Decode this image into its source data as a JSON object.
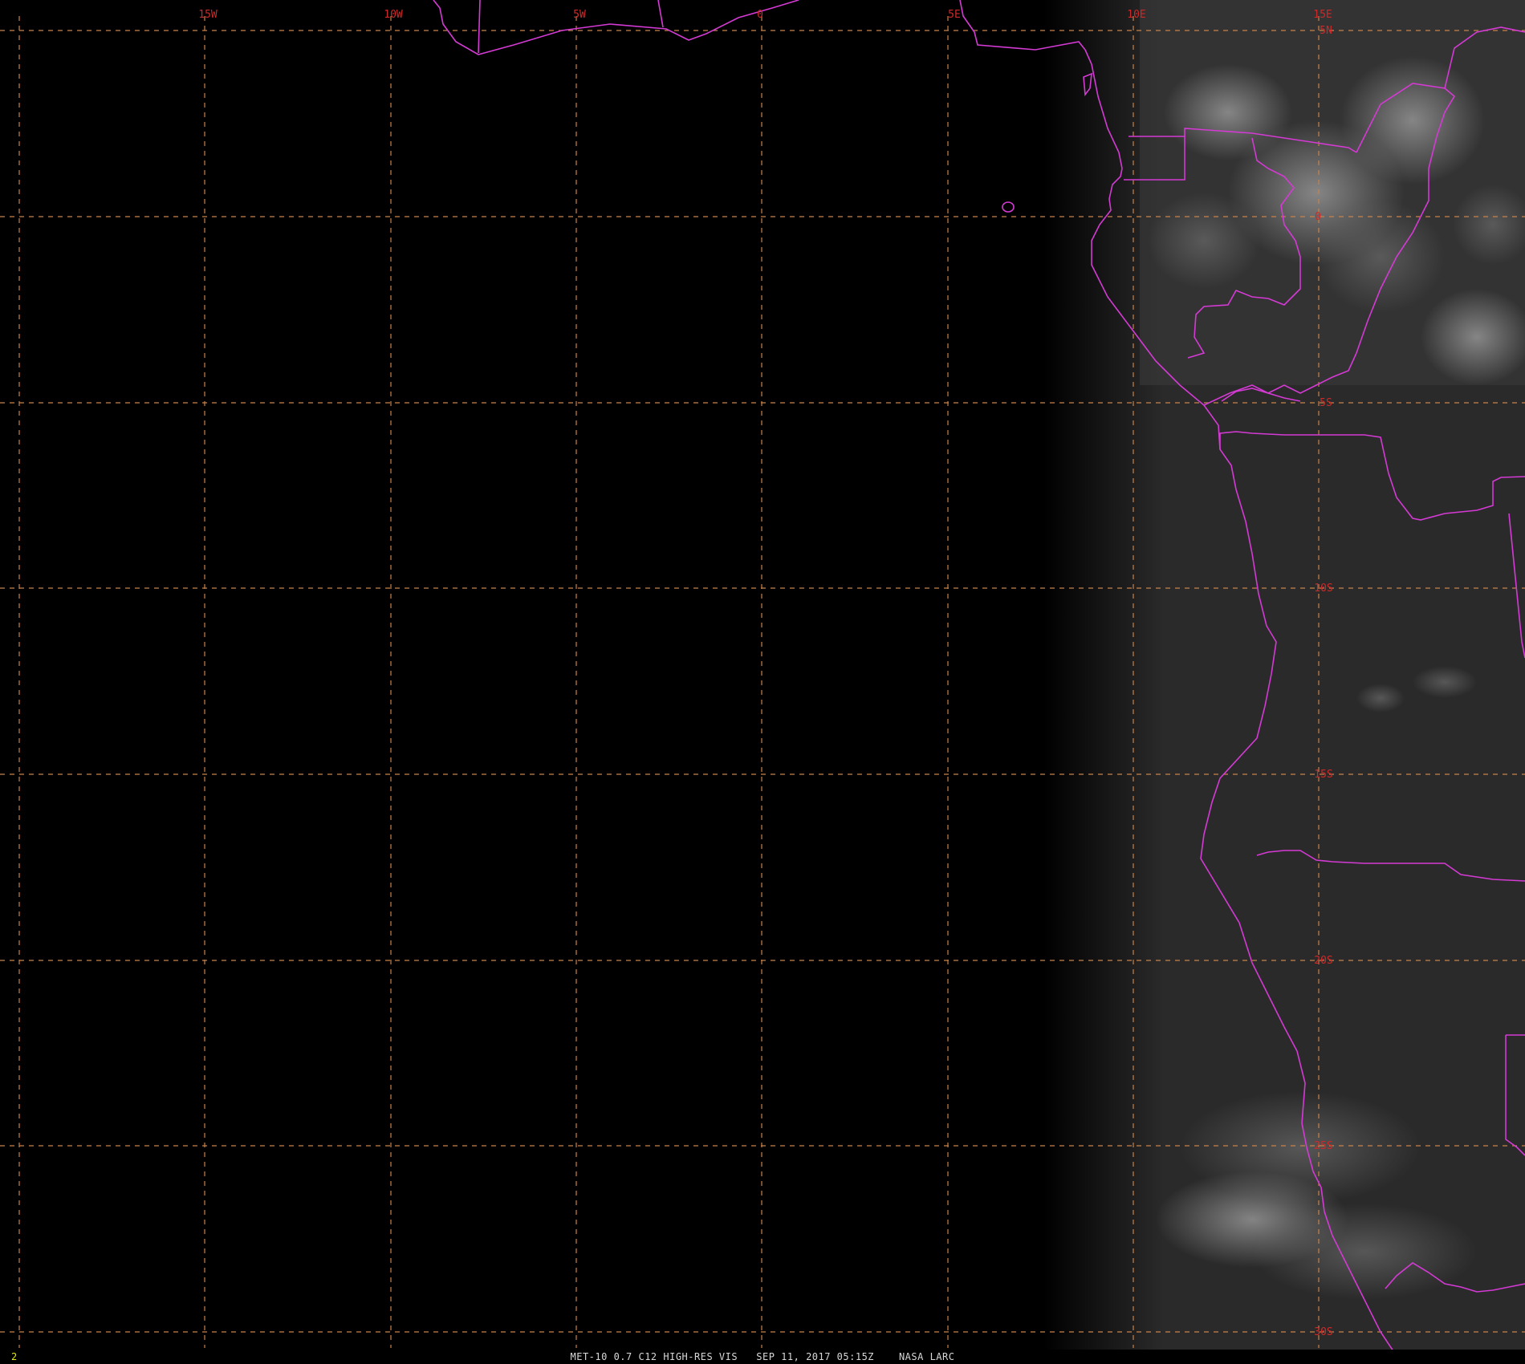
{
  "caption": {
    "frame_number": "2",
    "product": "MET-10 0.7 C12 HIGH-RES VIS",
    "timestamp": "SEP 11, 2017 05:15Z",
    "source": "NASA LARC"
  },
  "longitude_labels": [
    "15W",
    "10W",
    "5W",
    "0",
    "5E",
    "10E",
    "15E"
  ],
  "latitude_labels": [
    "5N",
    "0",
    "5S",
    "10S",
    "15S",
    "20S",
    "25S",
    "30S"
  ],
  "colors": {
    "background": "#000000",
    "grid_line": "#c8824a",
    "grid_label": "#cc2a2a",
    "borders": "#d43ad4",
    "frame_number": "#e6e600",
    "caption": "#d8d8d8",
    "land_visible": "#2e2e2e"
  },
  "features": [
    "africa-coastline",
    "country-borders",
    "lat-lon-graticule",
    "cloud-cover-visible"
  ]
}
